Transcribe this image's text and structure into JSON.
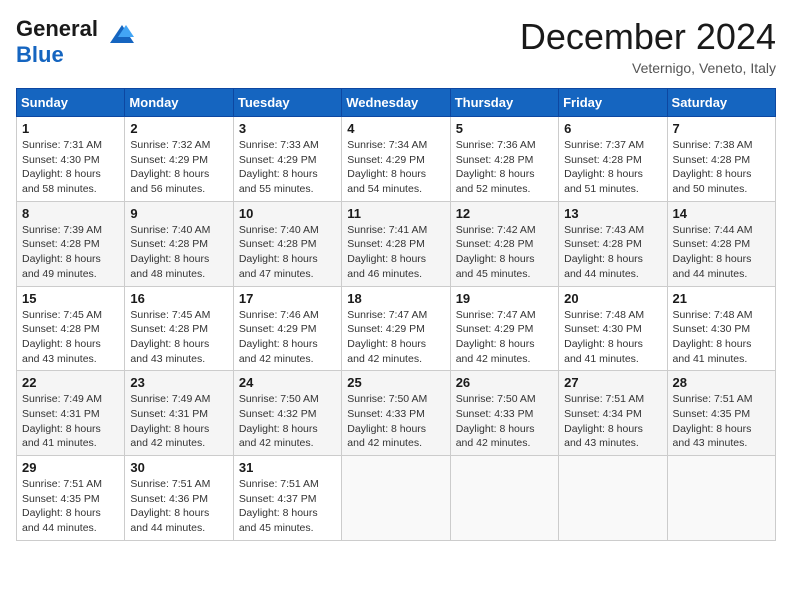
{
  "header": {
    "logo_general": "General",
    "logo_blue": "Blue",
    "month_title": "December 2024",
    "location": "Veternigo, Veneto, Italy"
  },
  "calendar": {
    "days_of_week": [
      "Sunday",
      "Monday",
      "Tuesday",
      "Wednesday",
      "Thursday",
      "Friday",
      "Saturday"
    ],
    "weeks": [
      [
        {
          "day": null
        },
        {
          "day": null
        },
        {
          "day": null
        },
        {
          "day": null
        },
        {
          "day": 5,
          "sunrise": "Sunrise: 7:36 AM",
          "sunset": "Sunset: 4:28 PM",
          "daylight": "Daylight: 8 hours and 52 minutes."
        },
        {
          "day": 6,
          "sunrise": "Sunrise: 7:37 AM",
          "sunset": "Sunset: 4:28 PM",
          "daylight": "Daylight: 8 hours and 51 minutes."
        },
        {
          "day": 7,
          "sunrise": "Sunrise: 7:38 AM",
          "sunset": "Sunset: 4:28 PM",
          "daylight": "Daylight: 8 hours and 50 minutes."
        }
      ],
      [
        {
          "day": 1,
          "sunrise": "Sunrise: 7:31 AM",
          "sunset": "Sunset: 4:30 PM",
          "daylight": "Daylight: 8 hours and 58 minutes."
        },
        {
          "day": 2,
          "sunrise": "Sunrise: 7:32 AM",
          "sunset": "Sunset: 4:29 PM",
          "daylight": "Daylight: 8 hours and 56 minutes."
        },
        {
          "day": 3,
          "sunrise": "Sunrise: 7:33 AM",
          "sunset": "Sunset: 4:29 PM",
          "daylight": "Daylight: 8 hours and 55 minutes."
        },
        {
          "day": 4,
          "sunrise": "Sunrise: 7:34 AM",
          "sunset": "Sunset: 4:29 PM",
          "daylight": "Daylight: 8 hours and 54 minutes."
        },
        {
          "day": 5,
          "sunrise": "Sunrise: 7:36 AM",
          "sunset": "Sunset: 4:28 PM",
          "daylight": "Daylight: 8 hours and 52 minutes."
        },
        {
          "day": 6,
          "sunrise": "Sunrise: 7:37 AM",
          "sunset": "Sunset: 4:28 PM",
          "daylight": "Daylight: 8 hours and 51 minutes."
        },
        {
          "day": 7,
          "sunrise": "Sunrise: 7:38 AM",
          "sunset": "Sunset: 4:28 PM",
          "daylight": "Daylight: 8 hours and 50 minutes."
        }
      ],
      [
        {
          "day": 8,
          "sunrise": "Sunrise: 7:39 AM",
          "sunset": "Sunset: 4:28 PM",
          "daylight": "Daylight: 8 hours and 49 minutes."
        },
        {
          "day": 9,
          "sunrise": "Sunrise: 7:40 AM",
          "sunset": "Sunset: 4:28 PM",
          "daylight": "Daylight: 8 hours and 48 minutes."
        },
        {
          "day": 10,
          "sunrise": "Sunrise: 7:40 AM",
          "sunset": "Sunset: 4:28 PM",
          "daylight": "Daylight: 8 hours and 47 minutes."
        },
        {
          "day": 11,
          "sunrise": "Sunrise: 7:41 AM",
          "sunset": "Sunset: 4:28 PM",
          "daylight": "Daylight: 8 hours and 46 minutes."
        },
        {
          "day": 12,
          "sunrise": "Sunrise: 7:42 AM",
          "sunset": "Sunset: 4:28 PM",
          "daylight": "Daylight: 8 hours and 45 minutes."
        },
        {
          "day": 13,
          "sunrise": "Sunrise: 7:43 AM",
          "sunset": "Sunset: 4:28 PM",
          "daylight": "Daylight: 8 hours and 44 minutes."
        },
        {
          "day": 14,
          "sunrise": "Sunrise: 7:44 AM",
          "sunset": "Sunset: 4:28 PM",
          "daylight": "Daylight: 8 hours and 44 minutes."
        }
      ],
      [
        {
          "day": 15,
          "sunrise": "Sunrise: 7:45 AM",
          "sunset": "Sunset: 4:28 PM",
          "daylight": "Daylight: 8 hours and 43 minutes."
        },
        {
          "day": 16,
          "sunrise": "Sunrise: 7:45 AM",
          "sunset": "Sunset: 4:28 PM",
          "daylight": "Daylight: 8 hours and 43 minutes."
        },
        {
          "day": 17,
          "sunrise": "Sunrise: 7:46 AM",
          "sunset": "Sunset: 4:29 PM",
          "daylight": "Daylight: 8 hours and 42 minutes."
        },
        {
          "day": 18,
          "sunrise": "Sunrise: 7:47 AM",
          "sunset": "Sunset: 4:29 PM",
          "daylight": "Daylight: 8 hours and 42 minutes."
        },
        {
          "day": 19,
          "sunrise": "Sunrise: 7:47 AM",
          "sunset": "Sunset: 4:29 PM",
          "daylight": "Daylight: 8 hours and 42 minutes."
        },
        {
          "day": 20,
          "sunrise": "Sunrise: 7:48 AM",
          "sunset": "Sunset: 4:30 PM",
          "daylight": "Daylight: 8 hours and 41 minutes."
        },
        {
          "day": 21,
          "sunrise": "Sunrise: 7:48 AM",
          "sunset": "Sunset: 4:30 PM",
          "daylight": "Daylight: 8 hours and 41 minutes."
        }
      ],
      [
        {
          "day": 22,
          "sunrise": "Sunrise: 7:49 AM",
          "sunset": "Sunset: 4:31 PM",
          "daylight": "Daylight: 8 hours and 41 minutes."
        },
        {
          "day": 23,
          "sunrise": "Sunrise: 7:49 AM",
          "sunset": "Sunset: 4:31 PM",
          "daylight": "Daylight: 8 hours and 42 minutes."
        },
        {
          "day": 24,
          "sunrise": "Sunrise: 7:50 AM",
          "sunset": "Sunset: 4:32 PM",
          "daylight": "Daylight: 8 hours and 42 minutes."
        },
        {
          "day": 25,
          "sunrise": "Sunrise: 7:50 AM",
          "sunset": "Sunset: 4:33 PM",
          "daylight": "Daylight: 8 hours and 42 minutes."
        },
        {
          "day": 26,
          "sunrise": "Sunrise: 7:50 AM",
          "sunset": "Sunset: 4:33 PM",
          "daylight": "Daylight: 8 hours and 42 minutes."
        },
        {
          "day": 27,
          "sunrise": "Sunrise: 7:51 AM",
          "sunset": "Sunset: 4:34 PM",
          "daylight": "Daylight: 8 hours and 43 minutes."
        },
        {
          "day": 28,
          "sunrise": "Sunrise: 7:51 AM",
          "sunset": "Sunset: 4:35 PM",
          "daylight": "Daylight: 8 hours and 43 minutes."
        }
      ],
      [
        {
          "day": 29,
          "sunrise": "Sunrise: 7:51 AM",
          "sunset": "Sunset: 4:35 PM",
          "daylight": "Daylight: 8 hours and 44 minutes."
        },
        {
          "day": 30,
          "sunrise": "Sunrise: 7:51 AM",
          "sunset": "Sunset: 4:36 PM",
          "daylight": "Daylight: 8 hours and 44 minutes."
        },
        {
          "day": 31,
          "sunrise": "Sunrise: 7:51 AM",
          "sunset": "Sunset: 4:37 PM",
          "daylight": "Daylight: 8 hours and 45 minutes."
        },
        {
          "day": null
        },
        {
          "day": null
        },
        {
          "day": null
        },
        {
          "day": null
        }
      ]
    ]
  }
}
